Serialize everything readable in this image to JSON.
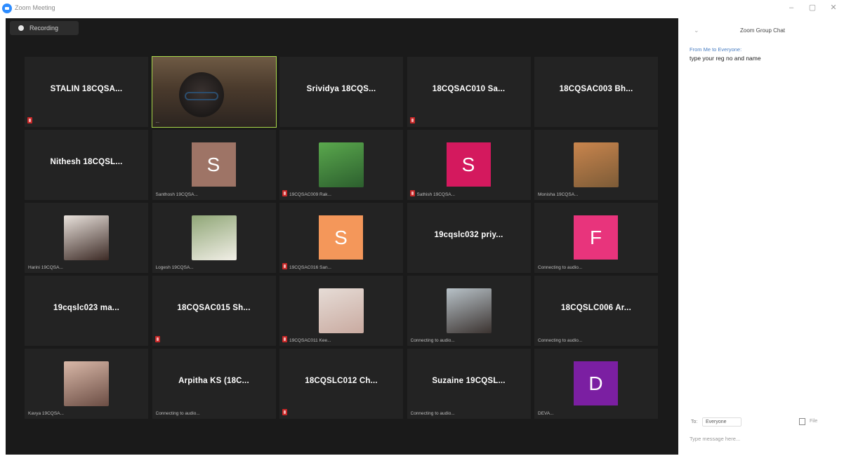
{
  "window": {
    "title": "Zoom Meeting",
    "controls": {
      "minimize": "–",
      "maximize": "▢",
      "close": "✕"
    }
  },
  "meeting": {
    "recording_label": "Recording",
    "tiles": [
      {
        "type": "name",
        "name": "STALIN 18CQSA...",
        "label": "",
        "muted": true
      },
      {
        "type": "video",
        "name": "",
        "label": "...",
        "muted": false,
        "speaking": true
      },
      {
        "type": "name",
        "name": "Srividya 18CQS...",
        "label": "",
        "muted": false
      },
      {
        "type": "name",
        "name": "18CQSAC010 Sa...",
        "label": "",
        "muted": true
      },
      {
        "type": "name",
        "name": "18CQSAC003 Bh...",
        "label": "",
        "muted": false
      },
      {
        "type": "name",
        "name": "Nithesh 18CQSL...",
        "label": "",
        "muted": false
      },
      {
        "type": "avatar",
        "letter": "S",
        "color": "#9e7466",
        "label": "Santhosh 19CQSA...",
        "muted": false
      },
      {
        "type": "photo",
        "photo_icon": "participant-photo-icon",
        "photo_colors": [
          "#5aa84d",
          "#2c5f2e"
        ],
        "label": "19CQSAC009 Rak...",
        "muted": true
      },
      {
        "type": "avatar",
        "letter": "S",
        "color": "#d4195e",
        "label": "Sathish 19CQSA...",
        "muted": true
      },
      {
        "type": "photo",
        "photo_icon": "participant-photo-icon",
        "photo_colors": [
          "#c9854d",
          "#7c5b37"
        ],
        "label": "Monisha 19CQSA...",
        "muted": false
      },
      {
        "type": "photo",
        "photo_icon": "participant-photo-icon",
        "photo_colors": [
          "#e9e2dc",
          "#3c2a25"
        ],
        "label": "Harini 19CQSA...",
        "muted": false
      },
      {
        "type": "photo",
        "photo_icon": "participant-photo-icon",
        "photo_colors": [
          "#8fa676",
          "#f2efe7"
        ],
        "label": "Logesh 19CQSA...",
        "muted": false
      },
      {
        "type": "avatar",
        "letter": "S",
        "color": "#f4975a",
        "label": "19CQSAC016 San...",
        "muted": true
      },
      {
        "type": "name",
        "name": "19cqslc032 priy...",
        "label": "",
        "muted": false
      },
      {
        "type": "avatar",
        "letter": "F",
        "color": "#e8347c",
        "label": "Connecting to audio...",
        "muted": false
      },
      {
        "type": "name",
        "name": "19cqslc023 ma...",
        "label": "",
        "muted": false
      },
      {
        "type": "name",
        "name": "18CQSAC015 Sh...",
        "label": "",
        "muted": true
      },
      {
        "type": "photo",
        "photo_icon": "participant-photo-icon",
        "photo_colors": [
          "#e6dcd6",
          "#c9aaa0"
        ],
        "label": "19CQSAC011 Kee...",
        "muted": true
      },
      {
        "type": "photo",
        "photo_icon": "participant-photo-icon",
        "photo_colors": [
          "#b8c2c8",
          "#3b3330"
        ],
        "label": "Connecting to audio...",
        "muted": false
      },
      {
        "type": "name",
        "name": "18CQSLC006 Ar...",
        "label": "Connecting to audio...",
        "muted": false
      },
      {
        "type": "photo",
        "photo_icon": "participant-photo-icon",
        "photo_colors": [
          "#d9b8a8",
          "#6b4d44"
        ],
        "label": "Kavya 19CQSA...",
        "muted": false
      },
      {
        "type": "name",
        "name": "Arpitha KS (18C...",
        "label": "Connecting to audio...",
        "muted": false
      },
      {
        "type": "name",
        "name": "18CQSLC012 Ch...",
        "label": "",
        "muted": true
      },
      {
        "type": "name",
        "name": "Suzaine 19CQSL...",
        "label": "Connecting to audio...",
        "muted": false
      },
      {
        "type": "avatar",
        "letter": "D",
        "color": "#7b1fa2",
        "label": "DEVA...",
        "muted": false
      }
    ]
  },
  "chat": {
    "collapse_icon": "chevron-down-icon",
    "title": "Zoom Group Chat",
    "sender": "From Me to Everyone:",
    "message": "type your reg no and name",
    "to_label": "To:",
    "recipient": "Everyone",
    "file_icon": "file-icon",
    "more_label": "File",
    "input_placeholder": "Type message here..."
  }
}
